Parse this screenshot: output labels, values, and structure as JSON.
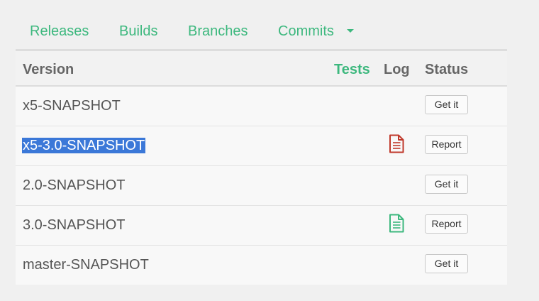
{
  "nav": {
    "releases": "Releases",
    "builds": "Builds",
    "branches": "Branches",
    "commits": "Commits"
  },
  "table": {
    "headers": {
      "version": "Version",
      "tests": "Tests",
      "log": "Log",
      "status": "Status"
    },
    "rows": [
      {
        "version": "x5-SNAPSHOT",
        "log": null,
        "status": "Get it"
      },
      {
        "version": "x5-3.0-SNAPSHOT",
        "log": "failed-log-icon",
        "status": "Report"
      },
      {
        "version": "2.0-SNAPSHOT",
        "log": null,
        "status": "Get it"
      },
      {
        "version": "3.0-SNAPSHOT",
        "log": "passed-log-icon",
        "status": "Report"
      },
      {
        "version": "master-SNAPSHOT",
        "log": null,
        "status": "Get it"
      }
    ]
  },
  "colors": {
    "accent": "#3db87e",
    "failed": "#c0392b",
    "passed": "#3db87e",
    "selection": "#3b78d8"
  }
}
